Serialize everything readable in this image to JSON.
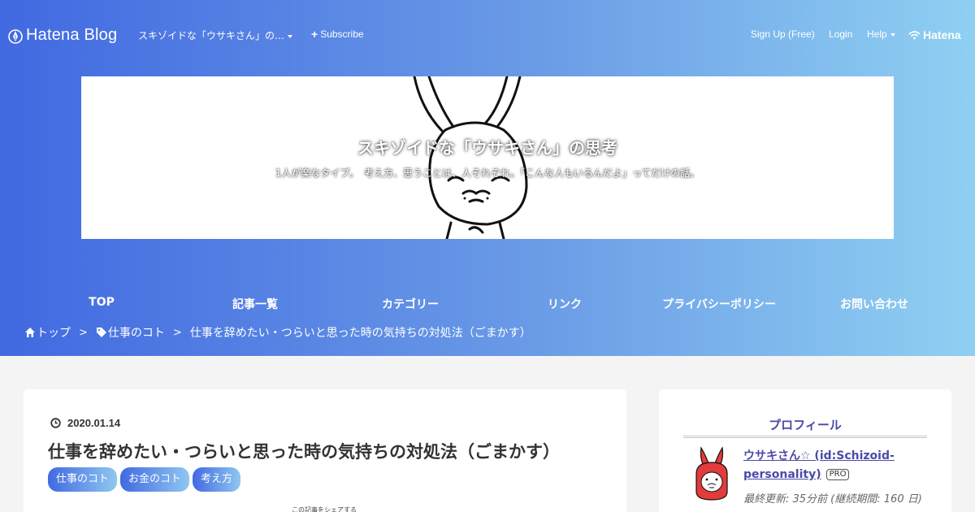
{
  "topbar": {
    "brand": "Hatena Blog",
    "blog_select": "スキゾイドな「ウサキさん」の…",
    "subscribe": "Subscribe",
    "signup": "Sign Up (Free)",
    "login": "Login",
    "help": "Help",
    "hatena": "Hatena"
  },
  "header": {
    "title": "スキゾイドな「ウサキさん」の思考",
    "description": "1人が楽なタイプ。　考え方、思うことは、人それぞれ。「こんな人もいるんだよ」ってだけの話。"
  },
  "nav": {
    "items": [
      "TOP",
      "記事一覧",
      "カテゴリー",
      "リンク",
      "プライバシーポリシー",
      "お問い合わせ"
    ]
  },
  "breadcrumb": {
    "home": "トップ",
    "separator": ">",
    "category": "仕事のコト",
    "current": "仕事を辞めたい・つらいと思った時の気持ちの対処法（ごまかす）"
  },
  "entry": {
    "date": "2020.01.14",
    "title": "仕事を辞めたい・つらいと思った時の気持ちの対処法（ごまかす）",
    "tags": [
      "仕事のコト",
      "お金のコト",
      "考え方"
    ],
    "share_label": "この記事をシェアする"
  },
  "sidebar": {
    "title": "プロフィール",
    "name": "ウサキさん☆ (id:Schizoid-personality)",
    "badge": "PRO",
    "last_updated": "最終更新: 35分前 (継続期間: 160 日)"
  },
  "colors": {
    "gradient_start": "#4169e1",
    "gradient_end": "#8fd0f2",
    "sidebar_accent": "#4a4aa8",
    "background": "#f4f4f4"
  }
}
